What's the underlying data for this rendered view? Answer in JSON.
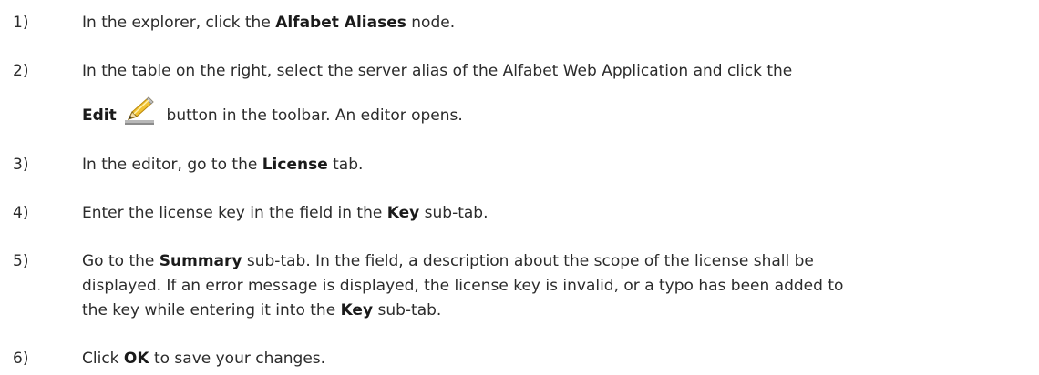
{
  "steps": [
    {
      "number": "1)",
      "parts": {
        "a": "In the explorer, click the ",
        "b": "Alfabet Aliases",
        "c": " node."
      }
    },
    {
      "number": "2)",
      "line1": "In the table on the right, select the server alias of the Alfabet Web Application and click the",
      "line2": {
        "b": "Edit",
        "c": " button in the toolbar. An editor opens."
      },
      "icon": "pencil-edit-icon"
    },
    {
      "number": "3)",
      "parts": {
        "a": "In the editor, go to the ",
        "b": "License",
        "c": " tab."
      }
    },
    {
      "number": "4)",
      "parts": {
        "a": "Enter the license key in the field in the ",
        "b": "Key",
        "c": " sub-tab."
      }
    },
    {
      "number": "5)",
      "line1": {
        "a": "Go to the ",
        "b": "Summary",
        "c": " sub-tab. In the field, a description about the scope of the license shall be"
      },
      "line2": "displayed. If an error message is displayed, the license key is invalid, or a typo has been added to",
      "line3": {
        "a": "the key while entering it into the ",
        "b": "Key",
        "c": " sub-tab."
      }
    },
    {
      "number": "6)",
      "parts": {
        "a": "Click ",
        "b": "OK",
        "c": " to save your changes."
      }
    }
  ]
}
